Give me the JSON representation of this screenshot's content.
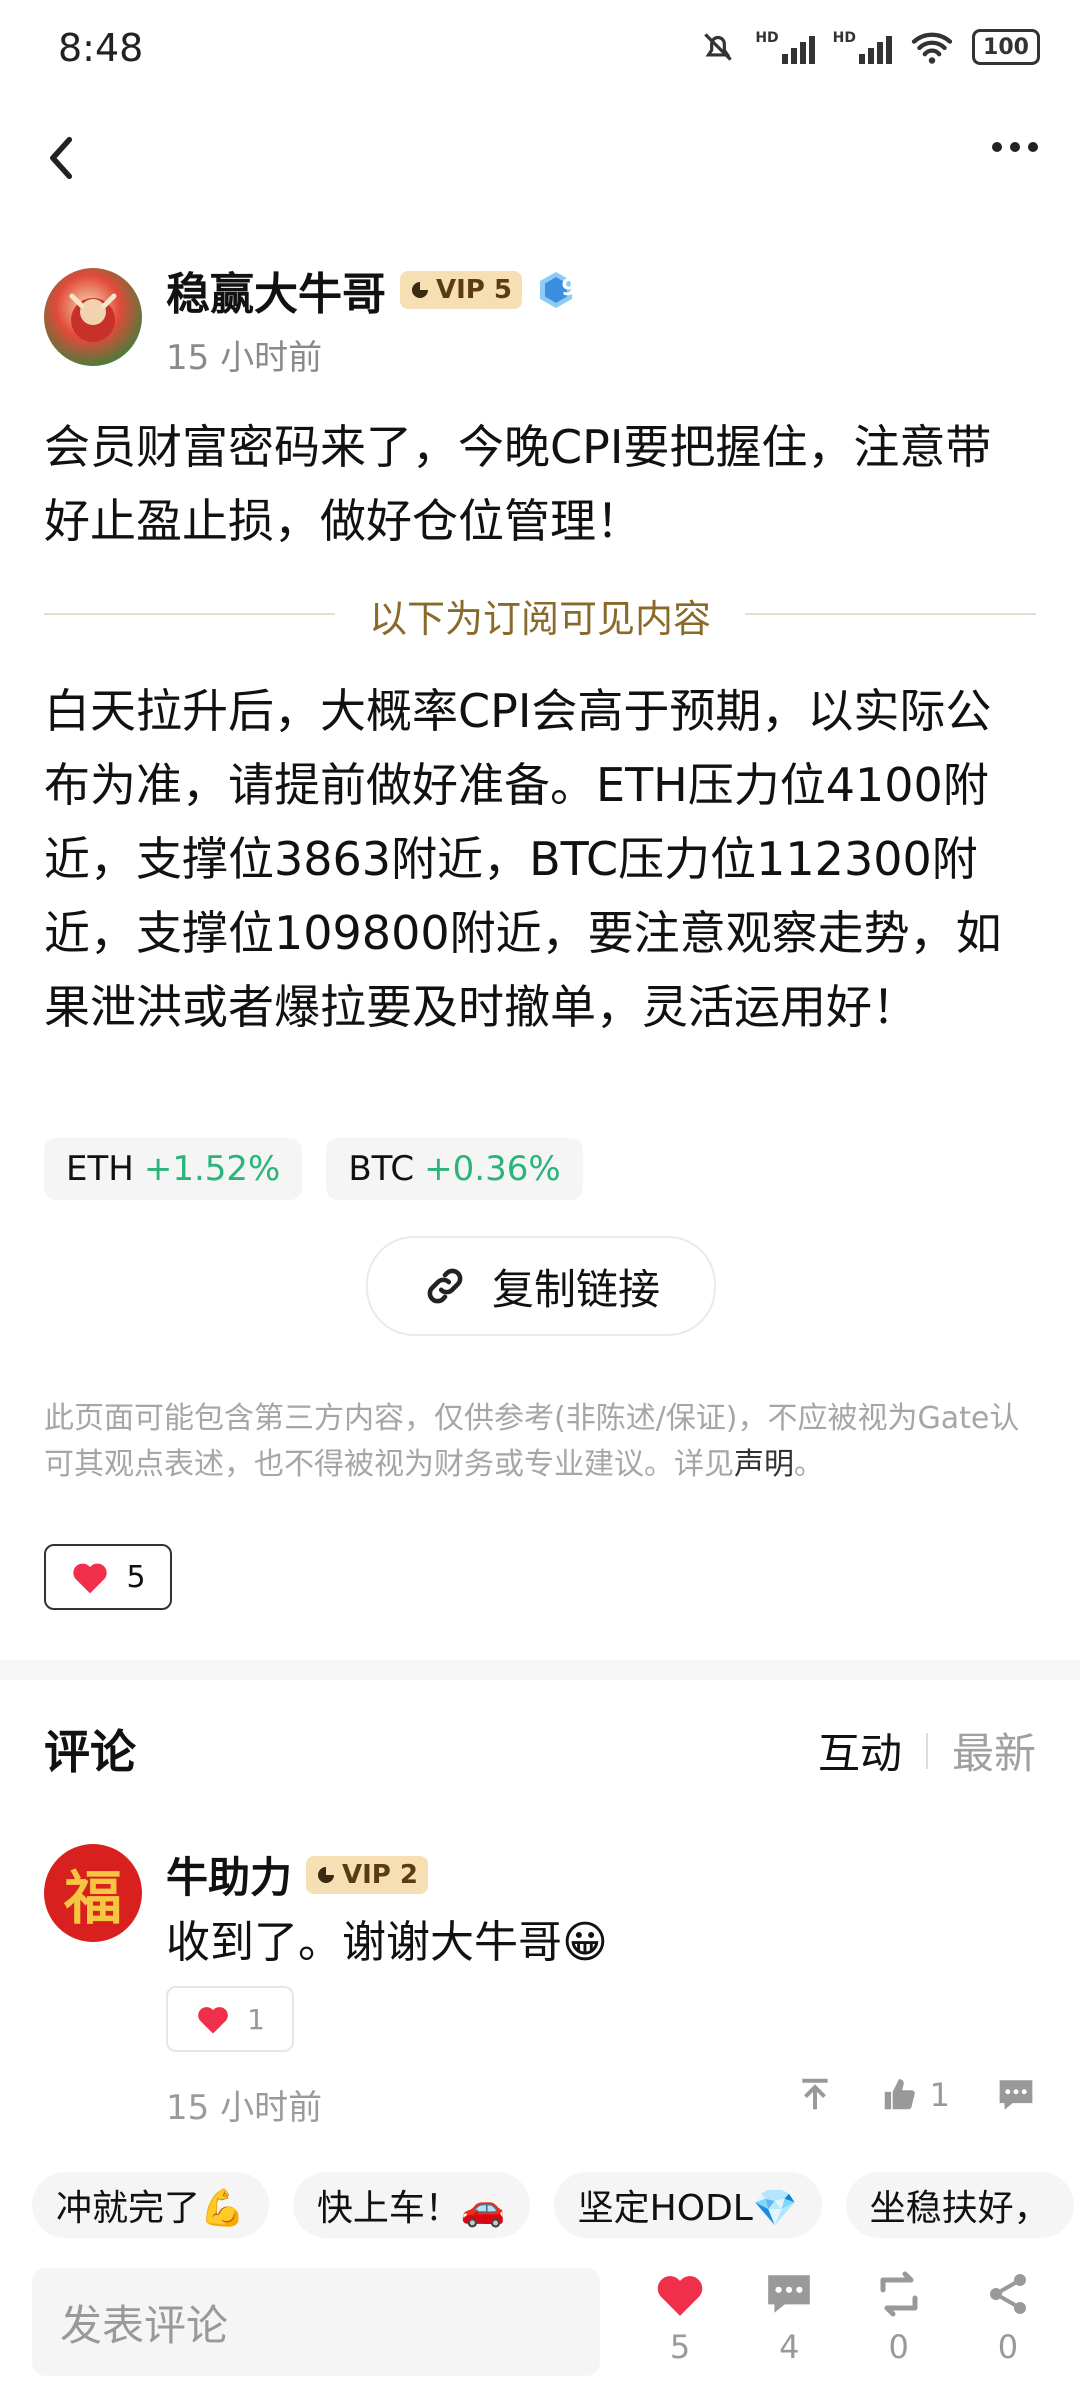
{
  "status": {
    "time": "8:48",
    "hd1": "HD",
    "hd2": "HD",
    "battery": "100"
  },
  "author": {
    "name": "稳赢大牛哥",
    "vip": "VIP 5",
    "level": "9",
    "time": "15 小时前"
  },
  "post": {
    "intro": "会员财富密码来了，今晚CPI要把握住，注意带好止盈止损，做好仓位管理！",
    "divider": "以下为订阅可见内容",
    "body": "白天拉升后，大概率CPI会高于预期，以实际公布为准，请提前做好准备。ETH压力位4100附近，支撑位3863附近，BTC压力位112300附近，支撑位109800附近，要注意观察走势，如果泄洪或者爆拉要及时撤单，灵活运用好！",
    "tickers": [
      {
        "symbol": "ETH",
        "change": "+1.52%"
      },
      {
        "symbol": "BTC",
        "change": "+0.36%"
      }
    ],
    "copy_link": "复制链接",
    "disclaimer_text": "此页面可能包含第三方内容，仅供参考(非陈述/保证)，不应被视为Gate认可其观点表述，也不得被视为财务或专业建议。详见",
    "disclaimer_link": "声明",
    "disclaimer_end": "。",
    "likes": "5"
  },
  "comments": {
    "title": "评论",
    "sort_active": "互动",
    "sort_inactive": "最新",
    "items": [
      {
        "name": "牛助力",
        "vip": "VIP 2",
        "avatar_char": "福",
        "text": "收到了。谢谢大牛哥😀",
        "likes": "1",
        "time": "15 小时前",
        "thumbs": "1"
      }
    ]
  },
  "quick_replies": [
    "冲就完了💪",
    "快上车！🚗",
    "坚定HODL💎",
    "坐稳扶好，"
  ],
  "composer": {
    "placeholder": "发表评论"
  },
  "bottom_bar": {
    "likes": "5",
    "comments": "4",
    "reposts": "0",
    "shares": "0"
  },
  "colors": {
    "accent_up": "#2bb47a",
    "like_red": "#f0304a",
    "vip_gold": "#f6dfb3"
  }
}
